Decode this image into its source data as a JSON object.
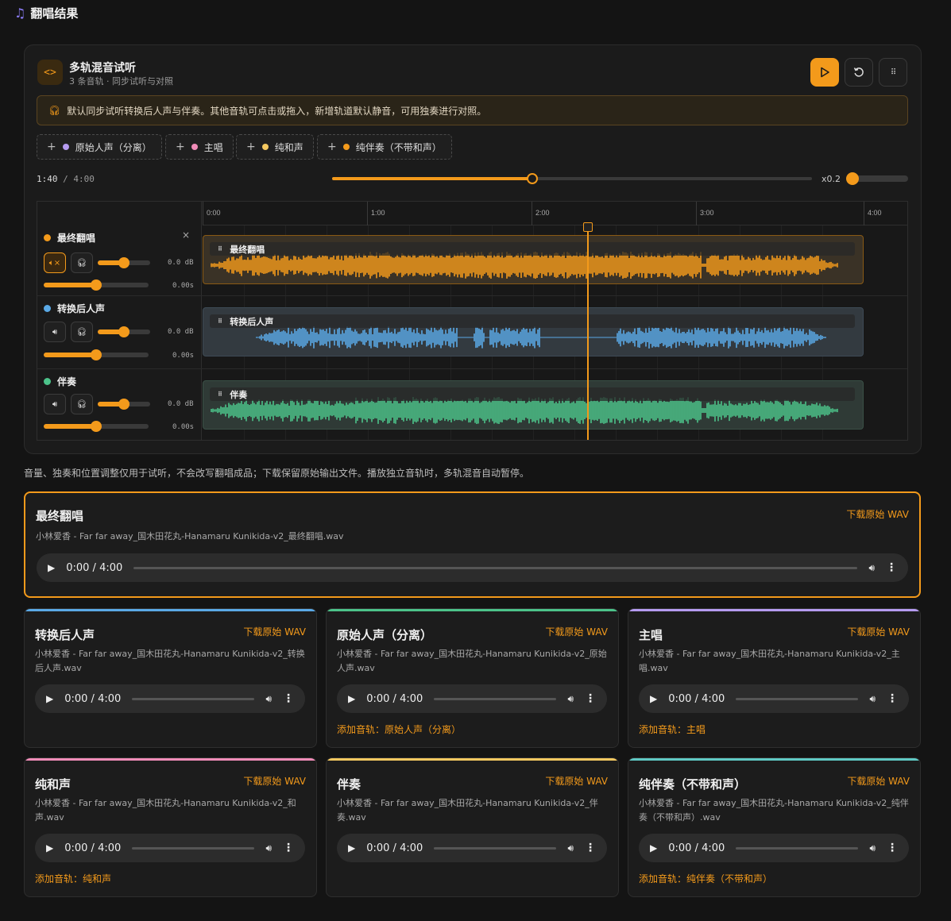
{
  "page": {
    "title": "翻唱结果"
  },
  "panel": {
    "title": "多轨混音试听",
    "subtitle": "3 条音轨 · 同步试听与对照",
    "notice": "默认同步试听转换后人声与伴奏。其他音轨可点击或拖入，新增轨道默认静音，可用独奏进行对照。",
    "add_tracks": [
      {
        "label": "原始人声（分离）",
        "color": "#b59bf0"
      },
      {
        "label": "主唱",
        "color": "#f08cb8"
      },
      {
        "label": "纯和声",
        "color": "#f4c860"
      },
      {
        "label": "纯伴奏（不带和声）",
        "color": "#f39a1b"
      }
    ],
    "current_time": "1:40",
    "total_time": "4:00",
    "progress": 0.417,
    "zoom": "x0.2",
    "ruler_ticks": [
      "0:00",
      "1:00",
      "2:00",
      "3:00",
      "4:00"
    ],
    "tracks": [
      {
        "name": "最终翻唱",
        "color": "#f39a1b",
        "db": "0.0 dB",
        "offset": "0.00s",
        "muted": true,
        "volume": 0.5,
        "clip_label": "最终翻唱",
        "close": "×"
      },
      {
        "name": "转换后人声",
        "color": "#5aa9e6",
        "db": "0.0 dB",
        "offset": "0.00s",
        "muted": false,
        "volume": 0.5,
        "clip_label": "转换后人声"
      },
      {
        "name": "伴奏",
        "color": "#4cc38a",
        "db": "0.0 dB",
        "offset": "0.00s",
        "muted": false,
        "volume": 0.5,
        "clip_label": "伴奏"
      }
    ]
  },
  "hint": "音量、独奏和位置调整仅用于试听，不会改写翻唱成品；下载保留原始输出文件。播放独立音轨时，多轨混音自动暂停。",
  "download_label": "下载原始 WAV",
  "player_time": "0:00 / 4:00",
  "featured": {
    "title": "最终翻唱",
    "file": "小林爱香 - Far far away_国木田花丸-Hanamaru Kunikida-v2_最终翻唱.wav"
  },
  "cards": [
    {
      "title": "转换后人声",
      "file": "小林爱香 - Far far away_国木田花丸-Hanamaru Kunikida-v2_转换后人声.wav",
      "accent": "#5aa9e6",
      "add": ""
    },
    {
      "title": "原始人声（分离）",
      "file": "小林爱香 - Far far away_国木田花丸-Hanamaru Kunikida-v2_原始人声.wav",
      "accent": "#4cc38a",
      "add": "添加音轨：原始人声（分离）"
    },
    {
      "title": "主唱",
      "file": "小林爱香 - Far far away_国木田花丸-Hanamaru Kunikida-v2_主唱.wav",
      "accent": "#b59bf0",
      "add": "添加音轨：主唱"
    },
    {
      "title": "纯和声",
      "file": "小林爱香 - Far far away_国木田花丸-Hanamaru Kunikida-v2_和声.wav",
      "accent": "#f08cb8",
      "add": "添加音轨：纯和声"
    },
    {
      "title": "伴奏",
      "file": "小林爱香 - Far far away_国木田花丸-Hanamaru Kunikida-v2_伴奏.wav",
      "accent": "#f4c860",
      "add": ""
    },
    {
      "title": "纯伴奏（不带和声）",
      "file": "小林爱香 - Far far away_国木田花丸-Hanamaru Kunikida-v2_纯伴奏（不带和声）.wav",
      "accent": "#5fc9c4",
      "add": "添加音轨：纯伴奏（不带和声）"
    }
  ]
}
